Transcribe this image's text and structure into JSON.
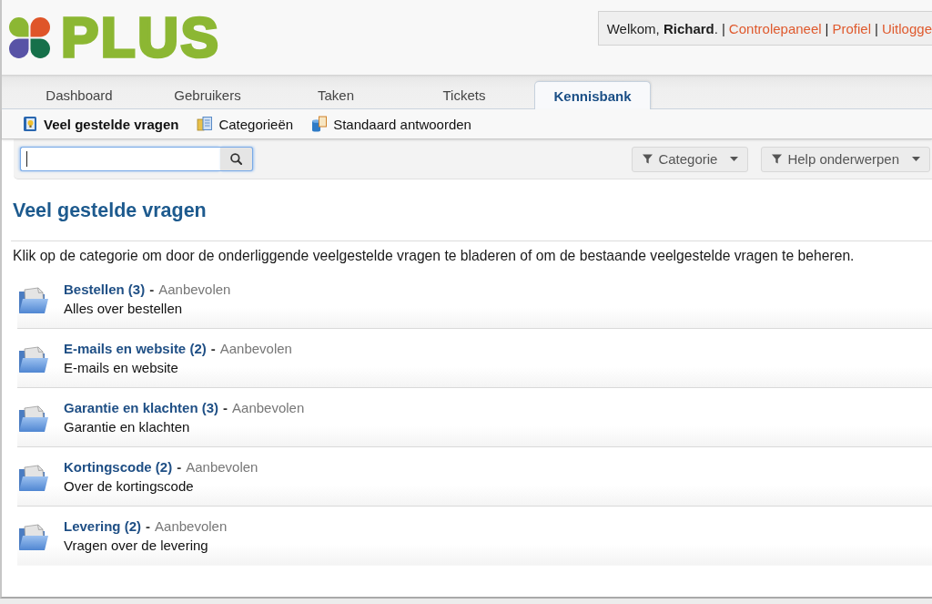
{
  "header": {
    "logo": {
      "text": "PLUS"
    },
    "user_bar": [
      {
        "kind": "text",
        "text": "Welkom, **Richard**."
      },
      {
        "kind": "separator",
        "text": "|"
      },
      {
        "kind": "link",
        "text": "Controlepaneel"
      },
      {
        "kind": "separator",
        "text": "|"
      },
      {
        "kind": "link",
        "text": "Profiel"
      },
      {
        "kind": "separator",
        "text": "|"
      },
      {
        "kind": "link",
        "text": "Uitlogge"
      }
    ]
  },
  "tabs": [
    {
      "label": "Dashboard",
      "selected": false
    },
    {
      "label": "Gebruikers",
      "selected": false
    },
    {
      "label": "Taken",
      "selected": false
    },
    {
      "label": "Tickets",
      "selected": false
    },
    {
      "label": "Kennisbank",
      "selected": true
    }
  ],
  "subnav": [
    {
      "label": "Veel gestelde vragen",
      "selected": true
    },
    {
      "label": "Categorieën",
      "selected": false
    },
    {
      "label": "Standaard antwoorden",
      "selected": false
    }
  ],
  "toolbar": {
    "search": {
      "focused": true
    },
    "filters": [
      {
        "label": "Categorie"
      },
      {
        "label": "Help onderwerpen"
      }
    ]
  },
  "content": {
    "title": "Veel gestelde vragen",
    "description": "Klik op de categorie om door de onderliggende veelgestelde vragen te bladeren of om de bestaande veelgestelde vragen te beheren.",
    "categories": [
      {
        "title": "Bestellen (3)",
        "dash": "-",
        "status": "Aanbevolen",
        "description": "Alles over bestellen"
      },
      {
        "title": "E-mails en website (2)",
        "dash": "-",
        "status": "Aanbevolen",
        "description": "E-mails en website"
      },
      {
        "title": "Garantie en klachten (3)",
        "dash": "-",
        "status": "Aanbevolen",
        "description": "Garantie en klachten"
      },
      {
        "title": "Kortingscode (2)",
        "dash": "-",
        "status": "Aanbevolen",
        "description": "Over de kortingscode"
      },
      {
        "title": "Levering (2)",
        "dash": "-",
        "status": "Aanbevolen",
        "description": "Vragen over de levering"
      }
    ]
  }
}
